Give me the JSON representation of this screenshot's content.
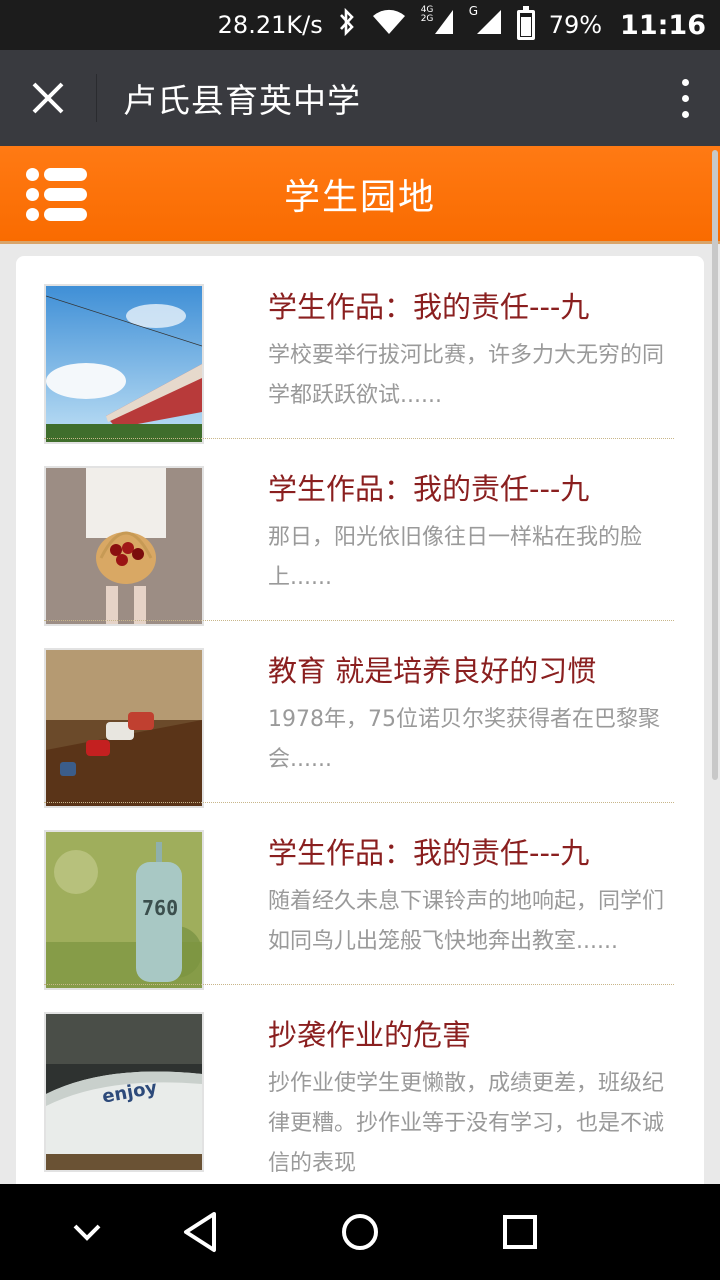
{
  "status_bar": {
    "speed": "28.21K/s",
    "network_small": "4G 2G",
    "signal_letter": "G",
    "battery_percent": "79%",
    "battery_level": 0.79,
    "time": "11:16",
    "icons": [
      "bluetooth-icon",
      "wifi-icon",
      "cell-signal-icon",
      "battery-icon"
    ]
  },
  "app_bar": {
    "title": "卢氏县育英中学",
    "icons": [
      "close-icon",
      "more-vert-icon"
    ]
  },
  "header": {
    "title": "学生园地",
    "accent_color": "#f96b00",
    "icons": [
      "menu-icon"
    ]
  },
  "articles": [
    {
      "title": "学生作品：我的责任---九",
      "summary": "学校要举行拔河比赛，许多力大无穷的同学都跃跃欲试......",
      "image": "train-photo"
    },
    {
      "title": "学生作品：我的责任---九",
      "summary": "那日，阳光依旧像往日一样粘在我的脸上......",
      "image": "cherry-basket-photo"
    },
    {
      "title": "教育 就是培养良好的习惯",
      "summary": "1978年，75位诺贝尔奖获得者在巴黎聚会......",
      "image": "toy-cars-photo"
    },
    {
      "title": "学生作品：我的责任---九",
      "summary": "随着经久未息下课铃声的地响起，同学们如同鸟儿出笼般飞快地奔出教室......",
      "image": "mailbox-photo",
      "mailbox_number": "760"
    },
    {
      "title": "抄袭作业的危害",
      "summary": "抄作业使学生更懒散，成绩更差，班级纪律更糟。抄作业等于没有学习，也是不诚信的表现",
      "image": "enjoy-mug-photo",
      "mug_text": "enjoy"
    }
  ],
  "nav_bar": {
    "icons": [
      "collapse-chevron-icon",
      "back-icon",
      "home-icon",
      "recents-icon"
    ]
  }
}
